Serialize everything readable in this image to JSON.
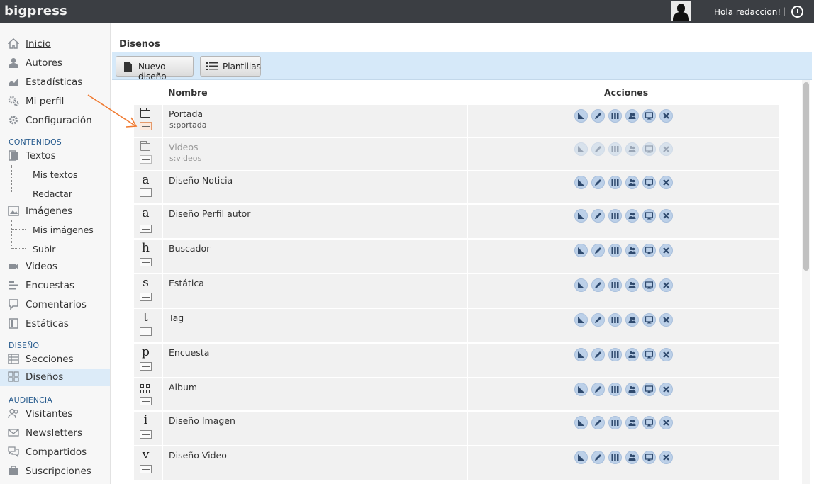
{
  "app": {
    "brand": "bigpress"
  },
  "header": {
    "greeting": "Hola redaccion!",
    "separator": "|"
  },
  "sidebar": {
    "inicio": "Inicio",
    "autores": "Autores",
    "estadisticas": "Estadísticas",
    "mi_perfil": "Mi perfil",
    "configuracion": "Configuración",
    "contenidos_header": "CONTENIDOS",
    "textos": "Textos",
    "mis_textos": "Mis textos",
    "redactar": "Redactar",
    "imagenes": "Imágenes",
    "mis_imagenes": "Mis imágenes",
    "subir": "Subir",
    "videos": "Videos",
    "encuestas": "Encuestas",
    "comentarios": "Comentarios",
    "estaticas": "Estáticas",
    "diseno_header": "DISEÑO",
    "secciones": "Secciones",
    "disenos": "Diseños",
    "audiencia_header": "AUDIENCIA",
    "visitantes": "Visitantes",
    "newsletters": "Newsletters",
    "compartidos": "Compartidos",
    "suscripciones": "Suscripciones"
  },
  "main": {
    "title": "Diseños",
    "toolbar": {
      "nuevo": "Nuevo diseño",
      "plantillas": "Plantillas"
    },
    "columns": {
      "nombre": "Nombre",
      "acciones": "Acciones"
    },
    "rows": [
      {
        "icon": "page-icon",
        "letter": "",
        "name": "Portada",
        "slug": "s:portada",
        "disabled": false
      },
      {
        "icon": "page-icon",
        "letter": "",
        "name": "Videos",
        "slug": "s:videos",
        "disabled": true
      },
      {
        "icon": "letter",
        "letter": "a",
        "name": "Diseño Noticia",
        "slug": "",
        "disabled": false
      },
      {
        "icon": "letter",
        "letter": "a",
        "name": "Diseño Perfil autor",
        "slug": "",
        "disabled": false
      },
      {
        "icon": "letter",
        "letter": "h",
        "name": "Buscador",
        "slug": "",
        "disabled": false
      },
      {
        "icon": "letter",
        "letter": "s",
        "name": "Estática",
        "slug": "",
        "disabled": false
      },
      {
        "icon": "letter",
        "letter": "t",
        "name": "Tag",
        "slug": "",
        "disabled": false
      },
      {
        "icon": "letter",
        "letter": "p",
        "name": "Encuesta",
        "slug": "",
        "disabled": false
      },
      {
        "icon": "grid-icon",
        "letter": "",
        "name": "Album",
        "slug": "",
        "disabled": false
      },
      {
        "icon": "letter",
        "letter": "i",
        "name": "Diseño Imagen",
        "slug": "",
        "disabled": false
      },
      {
        "icon": "letter",
        "letter": "v",
        "name": "Diseño Video",
        "slug": "",
        "disabled": false
      }
    ],
    "action_icons": [
      "triangle-ruler-icon",
      "pencil-icon",
      "columns-icon",
      "users-icon",
      "monitor-icon",
      "close-icon"
    ]
  },
  "colors": {
    "topbar": "#3b3e43",
    "toolbar": "#d6e9f9",
    "active_nav": "#dcebf8",
    "section_header": "#2a5d8f",
    "annotation_arrow": "#f07a30"
  }
}
